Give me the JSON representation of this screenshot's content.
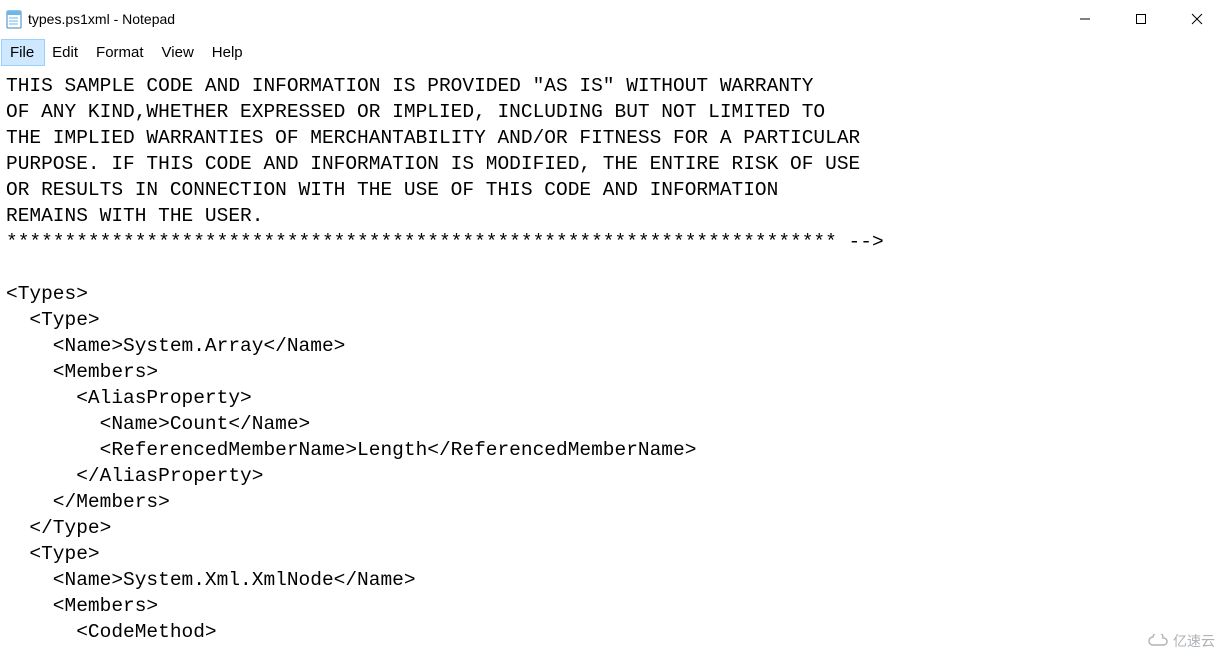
{
  "window": {
    "title": "types.ps1xml - Notepad"
  },
  "menu": {
    "file": "File",
    "edit": "Edit",
    "format": "Format",
    "view": "View",
    "help": "Help"
  },
  "editor": {
    "content": "THIS SAMPLE CODE AND INFORMATION IS PROVIDED \"AS IS\" WITHOUT WARRANTY\nOF ANY KIND,WHETHER EXPRESSED OR IMPLIED, INCLUDING BUT NOT LIMITED TO\nTHE IMPLIED WARRANTIES OF MERCHANTABILITY AND/OR FITNESS FOR A PARTICULAR\nPURPOSE. IF THIS CODE AND INFORMATION IS MODIFIED, THE ENTIRE RISK OF USE\nOR RESULTS IN CONNECTION WITH THE USE OF THIS CODE AND INFORMATION\nREMAINS WITH THE USER.\n*********************************************************************** -->\n\n<Types>\n  <Type>\n    <Name>System.Array</Name>\n    <Members>\n      <AliasProperty>\n        <Name>Count</Name>\n        <ReferencedMemberName>Length</ReferencedMemberName>\n      </AliasProperty>\n    </Members>\n  </Type>\n  <Type>\n    <Name>System.Xml.XmlNode</Name>\n    <Members>\n      <CodeMethod>"
  },
  "watermark": {
    "text": "亿速云"
  }
}
